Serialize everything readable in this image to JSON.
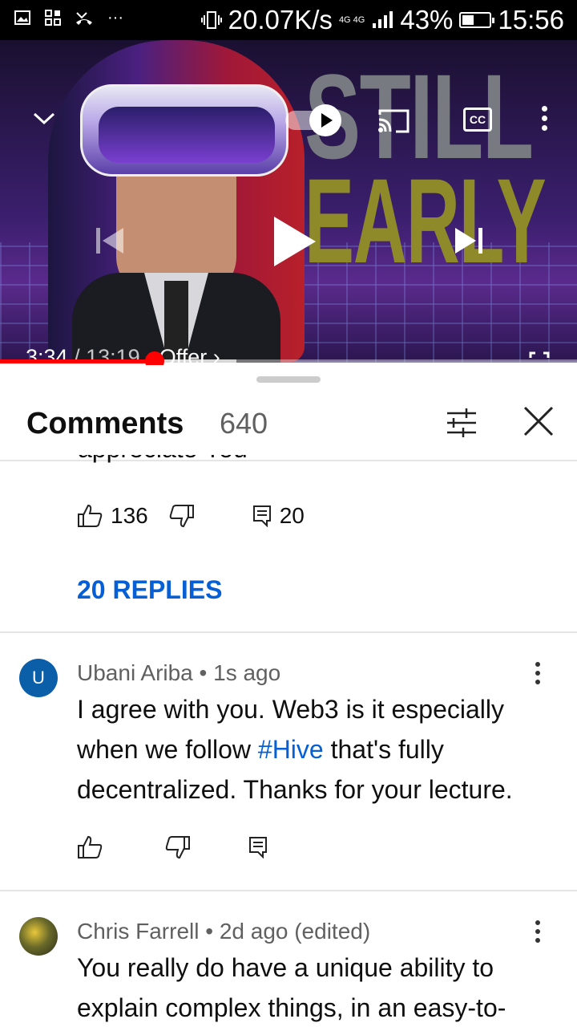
{
  "status_bar": {
    "speed": "20.07K/s",
    "network": "4G 4G",
    "battery": "43%",
    "time": "15:56",
    "icons": [
      "gallery-icon",
      "apps-icon",
      "missed-call-icon",
      "more-notifications-icon",
      "vibrate-icon",
      "signal-icon",
      "battery-icon"
    ]
  },
  "video": {
    "overlay_text_1": "STILL",
    "overlay_text_2": "EARLY",
    "current_time": "3:34",
    "separator": "/",
    "duration": "13:19",
    "offer_label": "· Offer ›",
    "progress": 0.268,
    "buffered": 0.41,
    "colors": {
      "progress": "#ff0000"
    }
  },
  "comments_panel": {
    "title": "Comments",
    "count": "640",
    "partial_text": "appreciate You",
    "first_actions": {
      "likes": "136",
      "replies": "20"
    },
    "replies_link": "20 REPLIES",
    "comments": [
      {
        "avatar_letter": "U",
        "avatar_color": "#0b5ea8",
        "meta": "Ubani Ariba • 1s ago",
        "text_before": "I agree with you. Web3 is it especially when we follow ",
        "hashtag": "#Hive",
        "text_after": " that's fully decentralized. Thanks for your lecture."
      },
      {
        "meta": "Chris Farrell • 2d ago (edited)",
        "text": "You really do have a unique ability to explain complex things, in an easy-to-"
      }
    ]
  }
}
